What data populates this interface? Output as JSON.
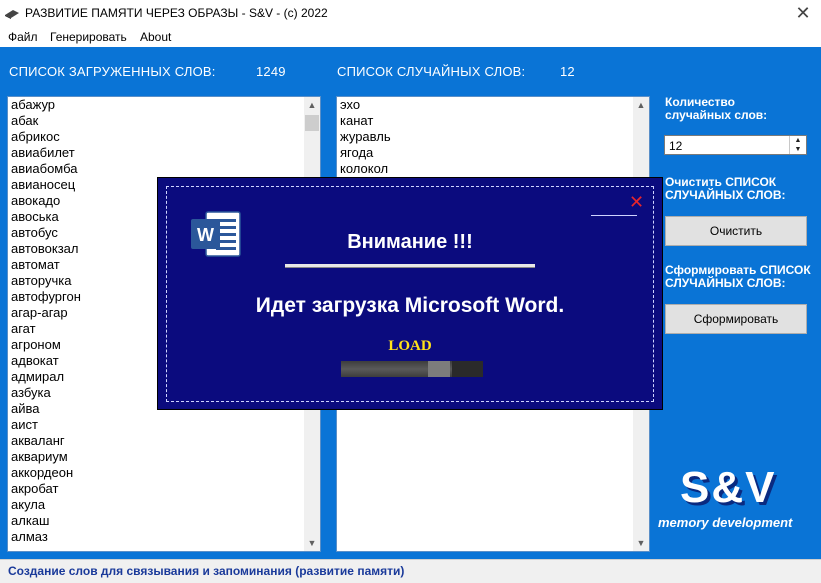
{
  "window": {
    "title": "РАЗВИТИЕ ПАМЯТИ ЧЕРЕЗ ОБРАЗЫ - S&V -  (c) 2022",
    "close_symbol": "✕"
  },
  "menu": [
    "Файл",
    "Генерировать",
    "About"
  ],
  "loaded_list": {
    "header": "СПИСОК ЗАГРУЖЕННЫХ СЛОВ:",
    "count": "1249",
    "items": [
      "абажур",
      "абак",
      "абрикос",
      "авиабилет",
      "авиабомба",
      "авианосец",
      "авокадо",
      "авоська",
      "автобус",
      "автовокзал",
      "автомат",
      "авторучка",
      "автофургон",
      "агар-агар",
      "агат",
      "агроном",
      "адвокат",
      "адмирал",
      "азбука",
      "айва",
      "аист",
      "акваланг",
      "аквариум",
      "аккордеон",
      "акробат",
      "акула",
      "алкаш",
      "алмаз"
    ]
  },
  "random_list": {
    "header": "СПИСОК СЛУЧАЙНЫХ СЛОВ:",
    "count": "12",
    "items": [
      "эхо",
      "канат",
      "журавль",
      "ягода",
      "колокол"
    ]
  },
  "controls": {
    "count_label": "Количество случайных слов:",
    "count_value": "12",
    "clear_label": "Очистить СПИСОК СЛУЧАЙНЫХ СЛОВ:",
    "clear_button": "Очистить",
    "form_label": "Сформировать СПИСОК СЛУЧАЙНЫХ СЛОВ:",
    "form_button": "Сформировать"
  },
  "logo": {
    "title": "S&V",
    "subtitle": "memory development"
  },
  "status": "Создание слов для связывания и запоминания (развитие памяти)",
  "dialog": {
    "title": "Внимание !!!",
    "message": "Идет загрузка Microsoft Word.",
    "load_label": "LOAD",
    "progress": 0.78,
    "close_symbol": "✕",
    "icon": "word-icon"
  },
  "colors": {
    "client_bg": "#0a74d6",
    "dialog_bg": "#0b0b7e",
    "load_text": "#ffe21a",
    "close_red": "#e8262c"
  }
}
